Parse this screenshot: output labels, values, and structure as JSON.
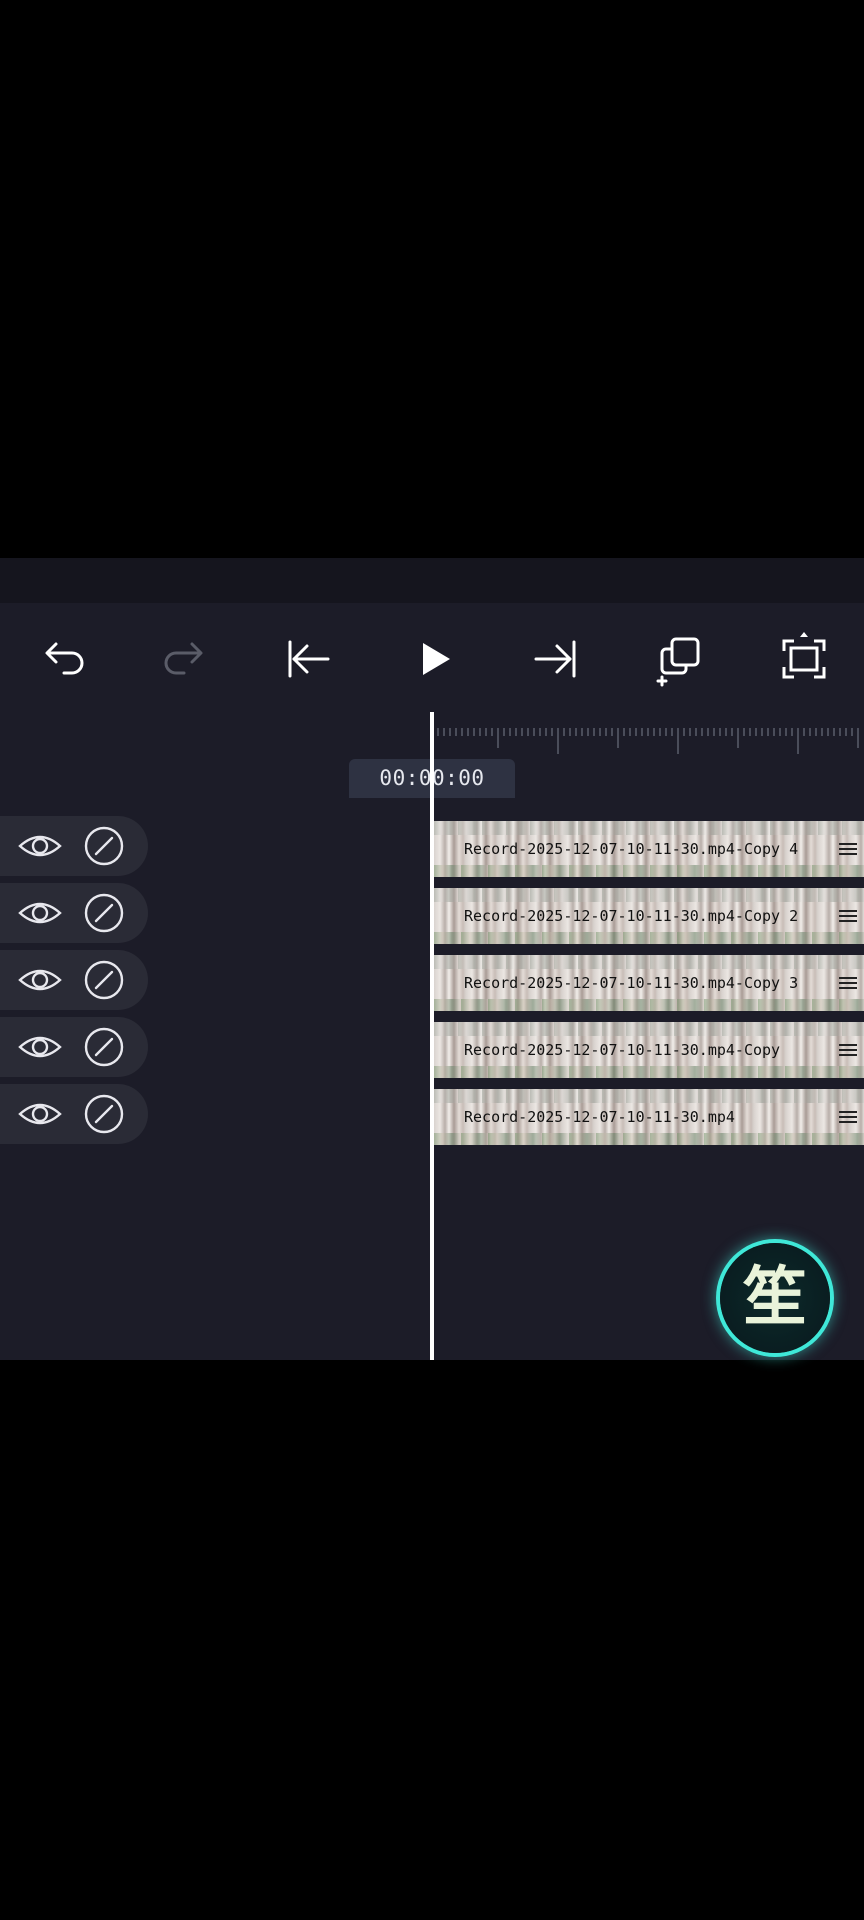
{
  "toolbar": {
    "undo": "undo-icon",
    "redo": "redo-icon",
    "skip_start": "skip-to-start-icon",
    "play": "play-icon",
    "skip_end": "skip-to-end-icon",
    "duplicate": "duplicate-icon",
    "fullscreen": "fullscreen-icon"
  },
  "timeline": {
    "timecode": "00:00:00"
  },
  "tracks": [
    {
      "clip_label": "Record-2025-12-07-10-11-30.mp4-Copy 4"
    },
    {
      "clip_label": "Record-2025-12-07-10-11-30.mp4-Copy 2"
    },
    {
      "clip_label": "Record-2025-12-07-10-11-30.mp4-Copy 3"
    },
    {
      "clip_label": "Record-2025-12-07-10-11-30.mp4-Copy"
    },
    {
      "clip_label": "Record-2025-12-07-10-11-30.mp4"
    }
  ],
  "avatar": {
    "glyph": "笙"
  },
  "colors": {
    "editor_bg": "#1c1c28",
    "track_ctrl_bg": "#2a2b36",
    "timecode_bg": "#2e3242",
    "accent_glow": "#3fe8d8"
  }
}
